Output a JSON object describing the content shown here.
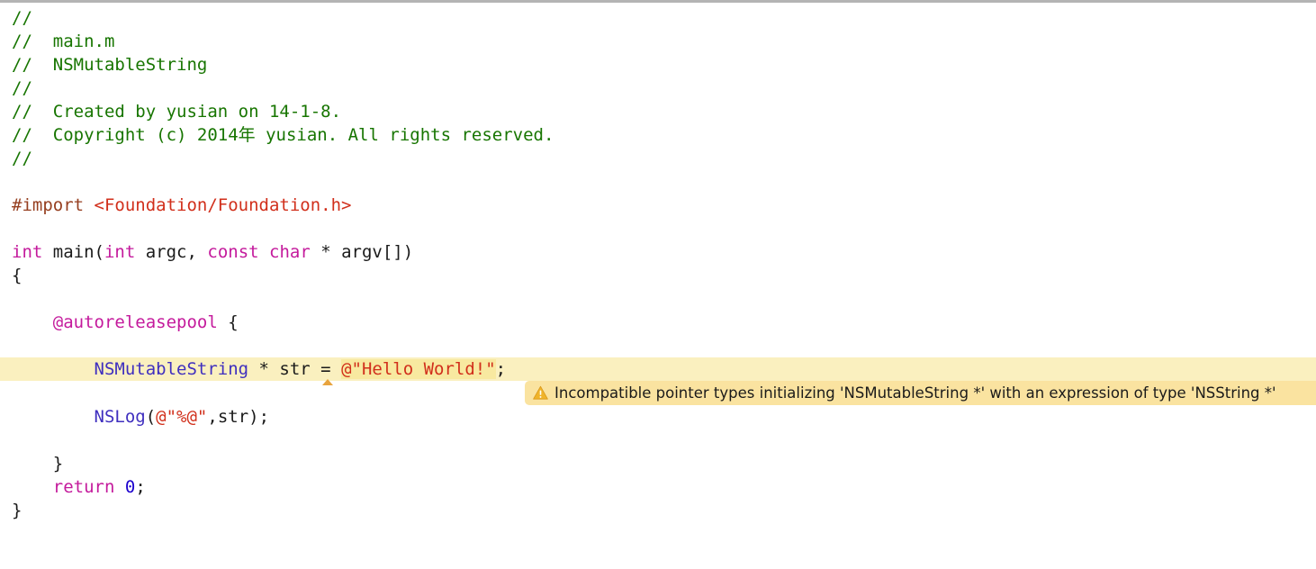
{
  "editor": {
    "language": "objective-c",
    "background_color": "#ffffff",
    "top_border_color": "#b4b4b4",
    "highlight_color": "#faf0bf",
    "string_highlight_color": "#f8e9a0",
    "warning_banner_color": "#fae3a0",
    "comment_color": "#177500",
    "keyword_color": "#c41a9c",
    "string_color": "#d12f1b",
    "type_color": "#3f2fbf",
    "number_color": "#1c01ce",
    "preprocessor_color": "#963f20"
  },
  "code": {
    "line_01": "//",
    "line_02_slashes": "//  ",
    "line_02_text": "main.m",
    "line_03_slashes": "//  ",
    "line_03_text": "NSMutableString",
    "line_04": "//",
    "line_05_slashes": "//  ",
    "line_05_text": "Created by yusian on 14-1-8.",
    "line_06_slashes": "//  ",
    "line_06_text": "Copyright (c) 2014年 yusian. All rights reserved.",
    "line_07": "//",
    "import_directive": "#import ",
    "import_header": "<Foundation/Foundation.h>",
    "main_ret_type": "int",
    "main_name": " main(",
    "main_arg1_type": "int",
    "main_arg1_name": " argc, ",
    "main_arg2_const": "const",
    "main_arg2_type": " char",
    "main_arg2_name": " * argv[])",
    "open_brace": "{",
    "autoreleasepool_keyword": "@autoreleasepool",
    "autoreleasepool_brace": " {",
    "decl_indent": "        ",
    "decl_type": "NSMutableString",
    "decl_var": " * str = ",
    "decl_string": "@\"Hello World!\"",
    "decl_semicolon": ";",
    "nslog_indent": "        ",
    "nslog_name": "NSLog",
    "nslog_open": "(",
    "nslog_format": "@\"%@\"",
    "nslog_args": ",str);",
    "close_brace_inner": "    }",
    "return_indent": "    ",
    "return_keyword": "return",
    "return_space": " ",
    "return_value": "0",
    "return_semicolon": ";",
    "close_brace_outer": "}"
  },
  "diagnostic": {
    "severity": "warning",
    "icon": "warning-triangle-icon",
    "message": "Incompatible pointer types initializing 'NSMutableString *' with an expression of type 'NSString *'",
    "fixit_marker": "caret-marker"
  }
}
